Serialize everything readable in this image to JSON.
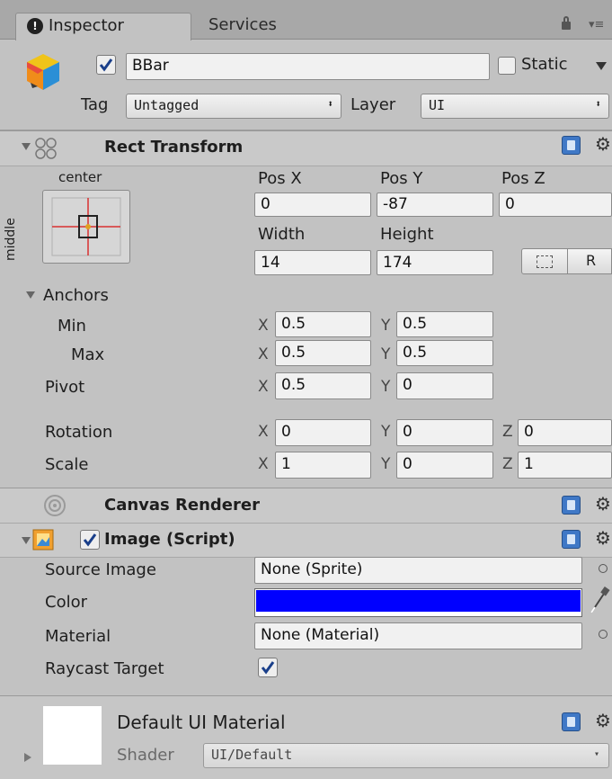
{
  "tabs": {
    "inspector": "Inspector",
    "services": "Services"
  },
  "object": {
    "name": "BBar",
    "active": true,
    "static_label": "Static",
    "tag_label": "Tag",
    "tag_value": "Untagged",
    "layer_label": "Layer",
    "layer_value": "UI"
  },
  "rect": {
    "title": "Rect Transform",
    "anchor_h": "center",
    "anchor_v": "middle",
    "pos_x_label": "Pos X",
    "pos_y_label": "Pos Y",
    "pos_z_label": "Pos Z",
    "pos_x": "0",
    "pos_y": "-87",
    "pos_z": "0",
    "width_label": "Width",
    "height_label": "Height",
    "width": "14",
    "height": "174",
    "raw_label": "R",
    "anchors_label": "Anchors",
    "min_label": "Min",
    "max_label": "Max",
    "min_x": "0.5",
    "min_y": "0.5",
    "max_x": "0.5",
    "max_y": "0.5",
    "pivot_label": "Pivot",
    "pivot_x": "0.5",
    "pivot_y": "0",
    "rotation_label": "Rotation",
    "rot_x": "0",
    "rot_y": "0",
    "rot_z": "0",
    "scale_label": "Scale",
    "scale_x": "1",
    "scale_y": "0",
    "scale_z": "1",
    "x": "X",
    "y": "Y",
    "z": "Z"
  },
  "canvas_renderer": {
    "title": "Canvas Renderer"
  },
  "image": {
    "title": "Image (Script)",
    "enabled": true,
    "source_label": "Source Image",
    "source_value": "None (Sprite)",
    "color_label": "Color",
    "color_value": "#0000ff",
    "material_label": "Material",
    "material_value": "None (Material)",
    "raycast_label": "Raycast Target",
    "raycast": true
  },
  "material": {
    "title": "Default UI Material",
    "shader_label": "Shader",
    "shader_value": "UI/Default"
  }
}
